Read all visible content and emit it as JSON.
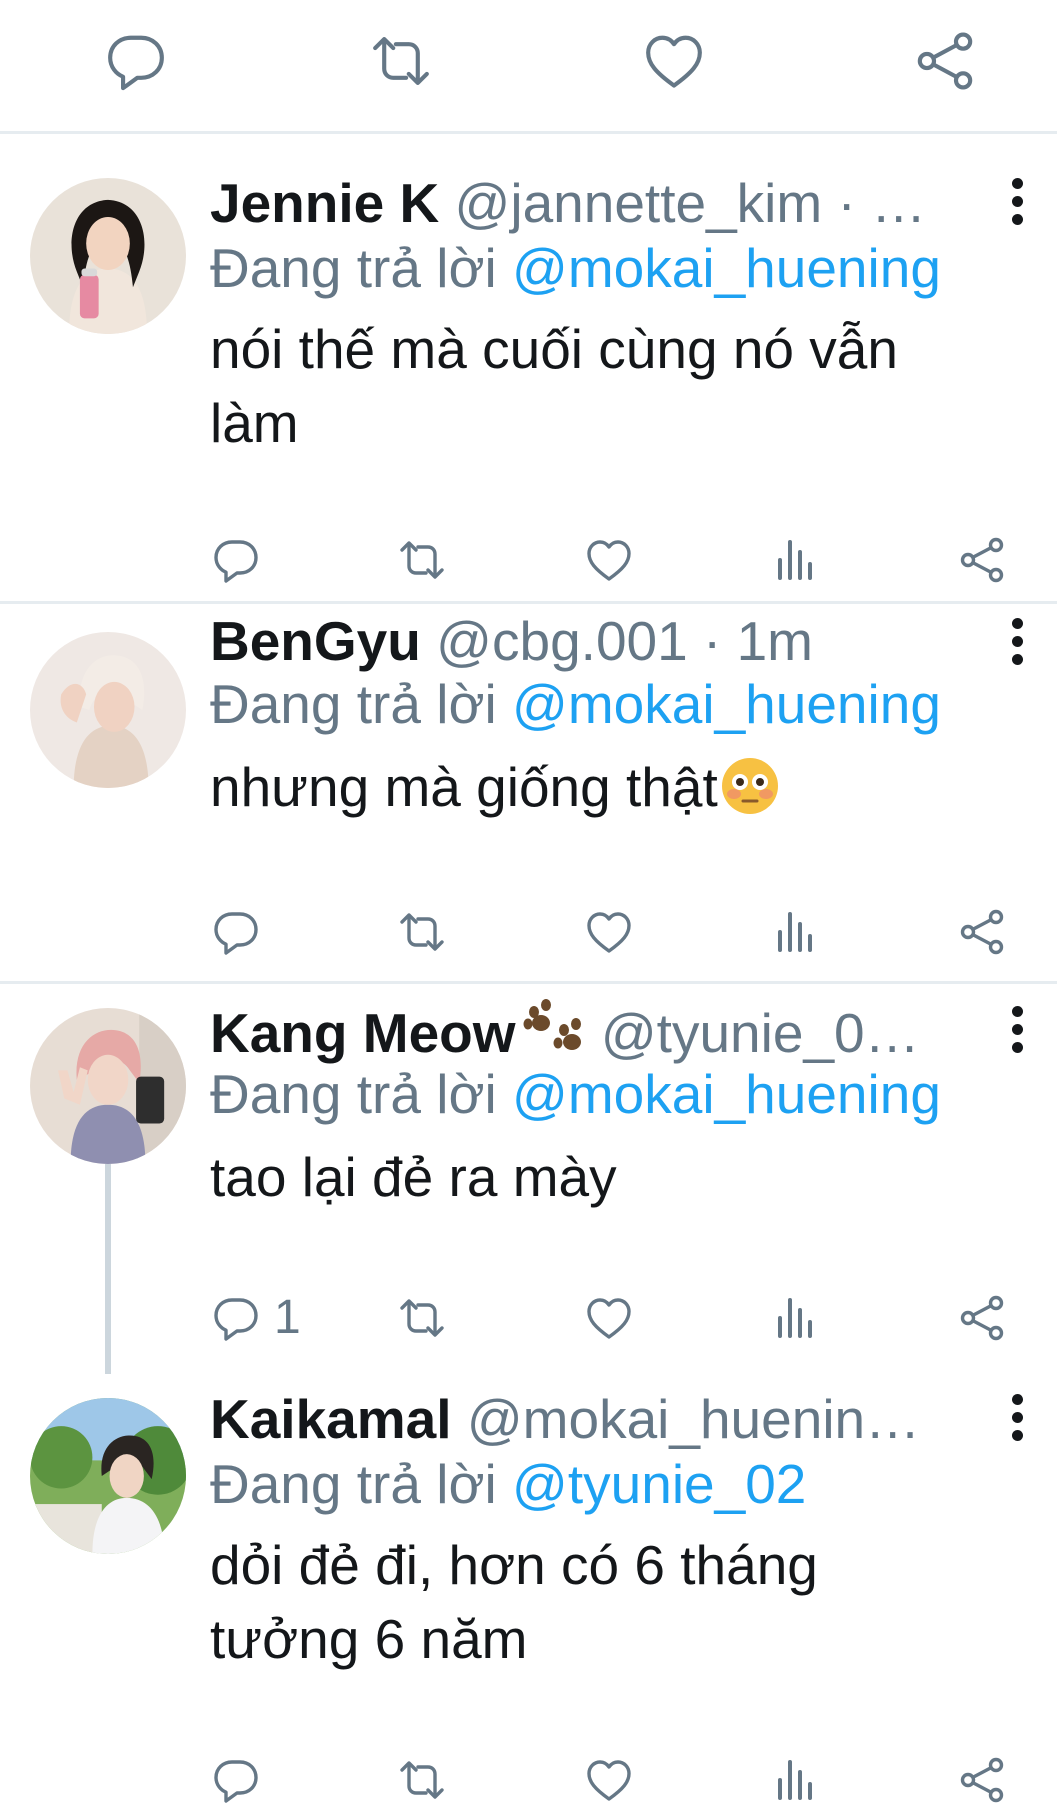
{
  "top_actions": {
    "icons": [
      "comment-icon",
      "retweet-icon",
      "heart-icon",
      "share-icon"
    ]
  },
  "replies": [
    {
      "display_name": "Jennie K",
      "handle": "@jannette_kim",
      "meta": " · …",
      "replying_label": "Đang trả lời ",
      "replying_to": "@mokai_huening",
      "text_line1": "nói thế mà cuối cùng nó vẫn",
      "text_line2": "làm",
      "reply_count": ""
    },
    {
      "display_name": "BenGyu",
      "handle": "@cbg.001",
      "meta": " · 1m",
      "replying_label": "Đang trả lời ",
      "replying_to": "@mokai_huening",
      "text_line1": "nhưng mà giống thật",
      "emoji": "flushed-face",
      "reply_count": ""
    },
    {
      "display_name": "Kang Meow",
      "name_emoji": "paw-prints",
      "handle": "@tyunie_0…",
      "meta": "",
      "replying_label": "Đang trả lời ",
      "replying_to": "@mokai_huening",
      "text_line1": "tao lại đẻ ra mày",
      "reply_count": "1"
    },
    {
      "display_name": "Kaikamal",
      "handle": "@mokai_huenin…",
      "meta": "",
      "replying_label": "Đang trả lời ",
      "replying_to": "@tyunie_02",
      "text_line1": "dỏi đẻ đi, hơn có 6 tháng",
      "text_line2": "tưởng 6 năm",
      "reply_count": ""
    }
  ],
  "colors": {
    "text": "#14171a",
    "secondary": "#657786",
    "link": "#1da1f2",
    "divider": "#e6ecf0",
    "thread": "#ccd6dd"
  }
}
